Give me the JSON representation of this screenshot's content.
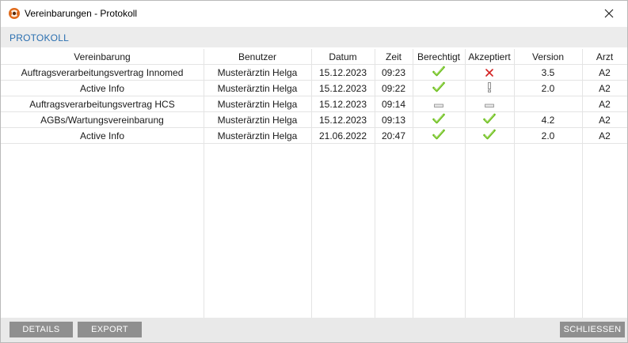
{
  "window": {
    "title": "Vereinbarungen - Protokoll"
  },
  "section": {
    "title": "PROTOKOLL"
  },
  "columns": [
    "Vereinbarung",
    "Benutzer",
    "Datum",
    "Zeit",
    "Berechtigt",
    "Akzeptiert",
    "Version",
    "Arzt"
  ],
  "rows": [
    {
      "vereinbarung": "Auftragsverarbeitungsvertrag Innomed",
      "benutzer": "Musterärztin Helga",
      "datum": "15.12.2023",
      "zeit": "09:23",
      "berechtigt": "check-icon",
      "akzeptiert": "cross-icon",
      "version": "3.5",
      "arzt": "A2"
    },
    {
      "vereinbarung": "Active Info",
      "benutzer": "Musterärztin Helga",
      "datum": "15.12.2023",
      "zeit": "09:22",
      "berechtigt": "check-icon",
      "akzeptiert": "exclamation-icon",
      "version": "2.0",
      "arzt": "A2"
    },
    {
      "vereinbarung": "Auftragsverarbeitungsvertrag HCS",
      "benutzer": "Musterärztin Helga",
      "datum": "15.12.2023",
      "zeit": "09:14",
      "berechtigt": "dash-icon",
      "akzeptiert": "dash-icon",
      "version": "",
      "arzt": "A2"
    },
    {
      "vereinbarung": "AGBs/Wartungsvereinbarung",
      "benutzer": "Musterärztin Helga",
      "datum": "15.12.2023",
      "zeit": "09:13",
      "berechtigt": "check-icon",
      "akzeptiert": "check-icon",
      "version": "4.2",
      "arzt": "A2"
    },
    {
      "vereinbarung": "Active Info",
      "benutzer": "Musterärztin Helga",
      "datum": "21.06.2022",
      "zeit": "20:47",
      "berechtigt": "check-icon",
      "akzeptiert": "check-icon",
      "version": "2.0",
      "arzt": "A2"
    }
  ],
  "footer": {
    "details_label": "DETAILS",
    "export_label": "EXPORT",
    "close_label": "SCHLIESSEN"
  },
  "colors": {
    "accent": "#2a6fb0",
    "check": "#6bbf1f",
    "cross": "#d32020",
    "button": "#8f8f8f"
  }
}
